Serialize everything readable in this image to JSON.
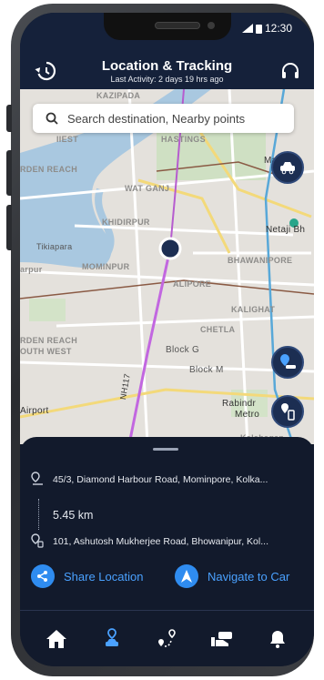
{
  "status": {
    "time": "12:30"
  },
  "header": {
    "title": "Location & Tracking",
    "subtitle": "Last Activity: 2 days 19 hrs ago",
    "left_icon": "history-icon",
    "right_icon": "headset-icon"
  },
  "search": {
    "placeholder": "Search destination, Nearby points"
  },
  "map": {
    "labels": [
      "KAZIPADA",
      "HASTINGS",
      "RDEN REACH",
      "WAT GANJ",
      "KHIDIRPUR",
      "Tikiapara",
      "arpur",
      "MOMINPUR",
      "ALIPORE",
      "BHAWANIPORE",
      "Netaji Bh",
      "KALIGHAT",
      "CHETLA",
      "RDEN REACH",
      "OUTH WEST",
      "Block G",
      "Block M",
      "Rabindr",
      "Metro",
      "Airport",
      "Kalabagan",
      "Ma",
      "NH117",
      "IIEST"
    ]
  },
  "trip": {
    "from": "45/3, Diamond Harbour Road, Mominpore, Kolka...",
    "distance": "5.45 km",
    "to": "101, Ashutosh Mukherjee Road, Bhowanipur, Kol..."
  },
  "actions": {
    "share_label": "Share Location",
    "navigate_label": "Navigate to Car"
  },
  "nav": {
    "items": [
      "home-icon",
      "car-location-icon",
      "route-icon",
      "car-service-icon",
      "bell-icon"
    ],
    "active_index": 1
  },
  "colors": {
    "accent": "#2f8cf0",
    "accent_text": "#4aa1ff",
    "header": "#15213a",
    "panel": "#121a2c"
  }
}
